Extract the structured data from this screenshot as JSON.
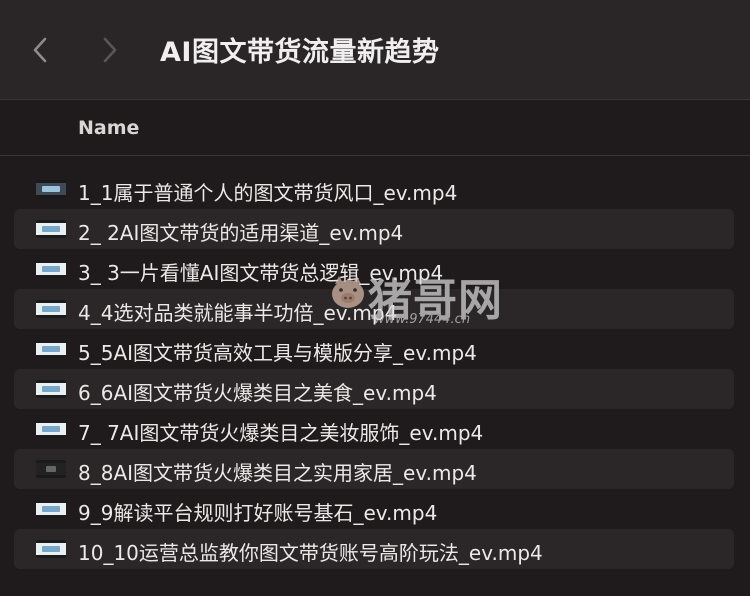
{
  "window": {
    "title": "AI图文带货流量新趋势"
  },
  "toolbar": {
    "back_icon": "chevron-left-icon",
    "forward_icon": "chevron-right-icon"
  },
  "list_header": {
    "name_column": "Name"
  },
  "files": [
    {
      "name": "1_1属于普通个人的图文带货风口_ev.mp4",
      "thumb": "dark"
    },
    {
      "name": "2_ 2AI图文带货的适用渠道_ev.mp4",
      "thumb": "light"
    },
    {
      "name": "3_ 3一片看懂AI图文带货总逻辑_ev.mp4",
      "thumb": "light"
    },
    {
      "name": "4_4选对品类就能事半功倍_ev.mp4",
      "thumb": "light"
    },
    {
      "name": "5_5AI图文带货高效工具与模版分享_ev.mp4",
      "thumb": "light"
    },
    {
      "name": "6_6AI图文带货火爆类目之美食_ev.mp4",
      "thumb": "light"
    },
    {
      "name": "7_ 7AI图文带货火爆类目之美妆服饰_ev.mp4",
      "thumb": "light"
    },
    {
      "name": "8_8AI图文带货火爆类目之实用家居_ev.mp4",
      "thumb": "black"
    },
    {
      "name": "9_9解读平台规则打好账号基石_ev.mp4",
      "thumb": "light"
    },
    {
      "name": "10_10运营总监教你图文带货账号高阶玩法_ev.mp4",
      "thumb": "light"
    }
  ],
  "watermark": {
    "text": "猪哥网",
    "url": "www.97444.cn"
  }
}
